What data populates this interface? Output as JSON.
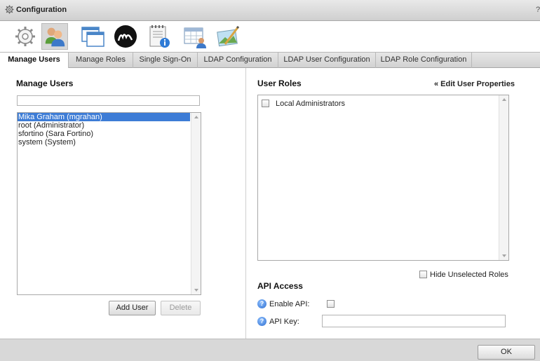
{
  "window": {
    "title": "Configuration",
    "help": "?"
  },
  "toolbar": {
    "icons": [
      "gear-settings-icon",
      "users-icon",
      "windows-icon",
      "m-logo-icon",
      "document-info-icon",
      "calendar-user-icon",
      "landscape-edit-icon"
    ],
    "active_index": 1
  },
  "tabs": [
    {
      "label": "Manage Users",
      "active": true
    },
    {
      "label": "Manage Roles"
    },
    {
      "label": "Single Sign-On"
    },
    {
      "label": "LDAP Configuration"
    },
    {
      "label": "LDAP User Configuration"
    },
    {
      "label": "LDAP Role Configuration"
    }
  ],
  "manage_users": {
    "heading": "Manage Users",
    "filter_value": "",
    "users": [
      {
        "label": "Mika Graham (mgrahan)",
        "selected": true
      },
      {
        "label": "root (Administrator)"
      },
      {
        "label": "sfortino (Sara Fortino)"
      },
      {
        "label": "system (System)"
      }
    ],
    "add_user_label": "Add User",
    "delete_label": "Delete"
  },
  "user_roles": {
    "heading": "User Roles",
    "edit_link": "« Edit User Properties",
    "roles": [
      {
        "label": "Local Administrators",
        "checked": false
      }
    ],
    "hide_unselected_label": "Hide Unselected Roles"
  },
  "api_access": {
    "heading": "API Access",
    "enable_label": "Enable API:",
    "key_label": "API Key:",
    "key_value": ""
  },
  "footer": {
    "ok_label": "OK"
  },
  "colors": {
    "selection": "#3d7cd6",
    "titlebar": "#d6d6d6",
    "footer": "#d8d8d8"
  }
}
